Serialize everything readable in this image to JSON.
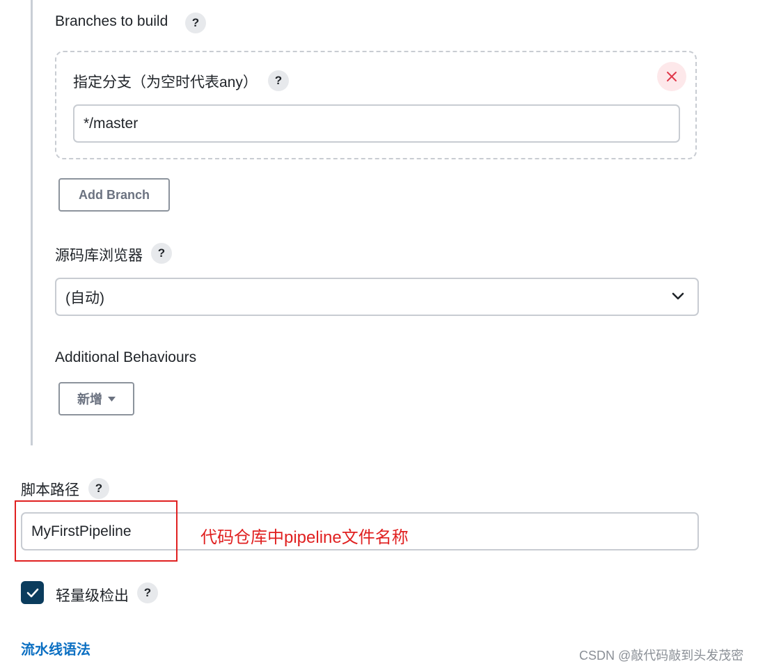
{
  "branches": {
    "title": "Branches to build",
    "help_symbol": "?",
    "branch_specifier": {
      "label": "指定分支（为空时代表any）",
      "value": "*/master",
      "delete_symbol": "×"
    },
    "add_branch_label": "Add Branch"
  },
  "repo_browser": {
    "label": "源码库浏览器",
    "selected": "(自动)"
  },
  "additional_behaviours": {
    "label": "Additional Behaviours",
    "add_label": "新增"
  },
  "script_path": {
    "label": "脚本路径",
    "value": "MyFirstPipeline"
  },
  "lightweight_checkout": {
    "label": "轻量级检出",
    "checked": true
  },
  "pipeline_syntax_link": "流水线语法",
  "annotation": {
    "text": "代码仓库中pipeline文件名称",
    "color": "#e02020"
  },
  "watermark": "CSDN @敲代码敲到头发茂密",
  "colors": {
    "checkbox": "#0b3c5d",
    "link": "#0b6fc2",
    "delete": "#e0394a"
  }
}
